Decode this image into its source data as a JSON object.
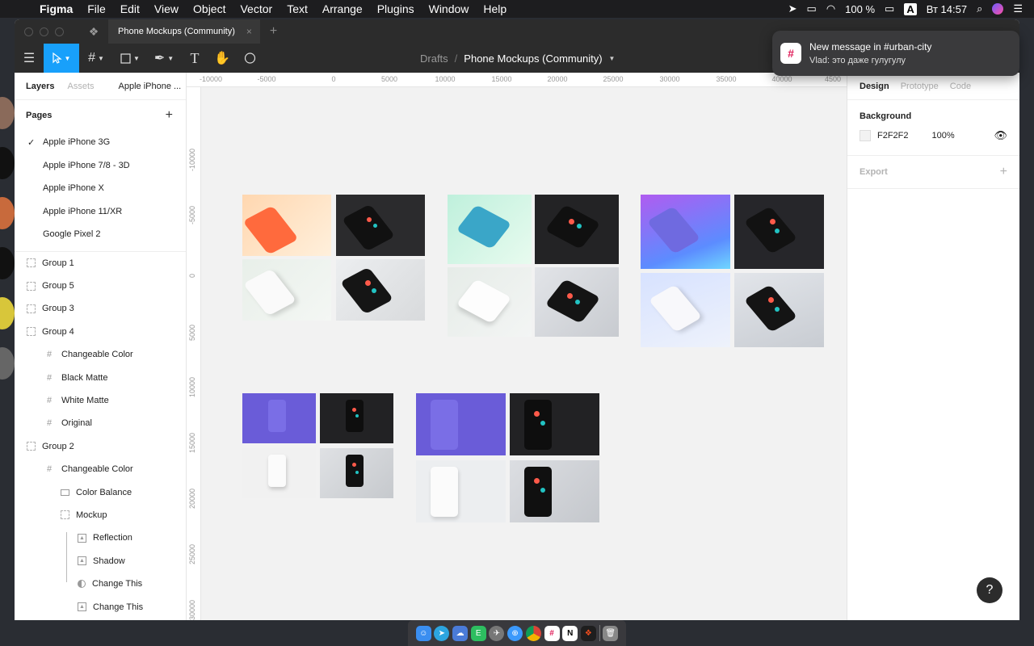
{
  "menubar": {
    "app": "Figma",
    "items": [
      "File",
      "Edit",
      "View",
      "Object",
      "Vector",
      "Text",
      "Arrange",
      "Plugins",
      "Window",
      "Help"
    ],
    "battery": "100 %",
    "input_source": "A",
    "clock": "Вт 14:57"
  },
  "tabbar": {
    "file_tab": "Phone Mockups (Community)",
    "close": "×",
    "new_tab": "+"
  },
  "toolbar": {
    "breadcrumb_root": "Drafts",
    "breadcrumb_sep": "/",
    "file_title": "Phone Mockups (Community)"
  },
  "left_panel": {
    "tabs": {
      "layers": "Layers",
      "assets": "Assets",
      "page_picker": "Apple iPhone ..."
    },
    "pages_title": "Pages",
    "add": "+",
    "pages": [
      {
        "label": "Apple iPhone 3G",
        "selected": true
      },
      {
        "label": "Apple iPhone 7/8 - 3D"
      },
      {
        "label": "Apple iPhone X"
      },
      {
        "label": "Apple iPhone 11/XR"
      },
      {
        "label": "Google Pixel 2"
      }
    ],
    "layers": [
      {
        "label": "Group 1",
        "icon": "group-icon"
      },
      {
        "label": "Group 5",
        "icon": "group-icon"
      },
      {
        "label": "Group 3",
        "icon": "group-icon"
      },
      {
        "label": "Group 4",
        "icon": "group-icon"
      },
      {
        "label": "Changeable Color",
        "icon": "frame-icon"
      },
      {
        "label": "Black Matte",
        "icon": "frame-icon"
      },
      {
        "label": "White Matte",
        "icon": "frame-icon"
      },
      {
        "label": "Original",
        "icon": "frame-icon"
      },
      {
        "label": "Group 2",
        "icon": "group-icon"
      },
      {
        "label": "Changeable Color",
        "icon": "frame-icon"
      },
      {
        "label": "Color Balance",
        "icon": "rectangle-icon"
      },
      {
        "label": "Mockup",
        "icon": "group-icon"
      },
      {
        "label": "Reflection",
        "icon": "image-icon"
      },
      {
        "label": "Shadow",
        "icon": "image-icon"
      },
      {
        "label": "Change This",
        "icon": "mask-icon"
      },
      {
        "label": "Change This",
        "icon": "image-icon"
      }
    ]
  },
  "rulers": {
    "top": [
      "-10000",
      "-5000",
      "0",
      "5000",
      "10000",
      "15000",
      "20000",
      "25000",
      "30000",
      "35000",
      "40000",
      "4500"
    ],
    "left": [
      "-10000",
      "-5000",
      "0",
      "5000",
      "10000",
      "15000",
      "20000",
      "25000",
      "30000"
    ]
  },
  "right_panel": {
    "tabs": {
      "design": "Design",
      "prototype": "Prototype",
      "code": "Code"
    },
    "background_title": "Background",
    "bg_hex": "F2F2F2",
    "bg_opacity": "100%",
    "export_title": "Export",
    "add": "+"
  },
  "help": "?",
  "notification": {
    "title": "New message in #urban-city",
    "body": "Vlad: это даже гулугулу"
  },
  "colors": {
    "accent": "#18a0fb",
    "toolbar": "#2c2c2c",
    "canvas": "#f2f2f2"
  }
}
